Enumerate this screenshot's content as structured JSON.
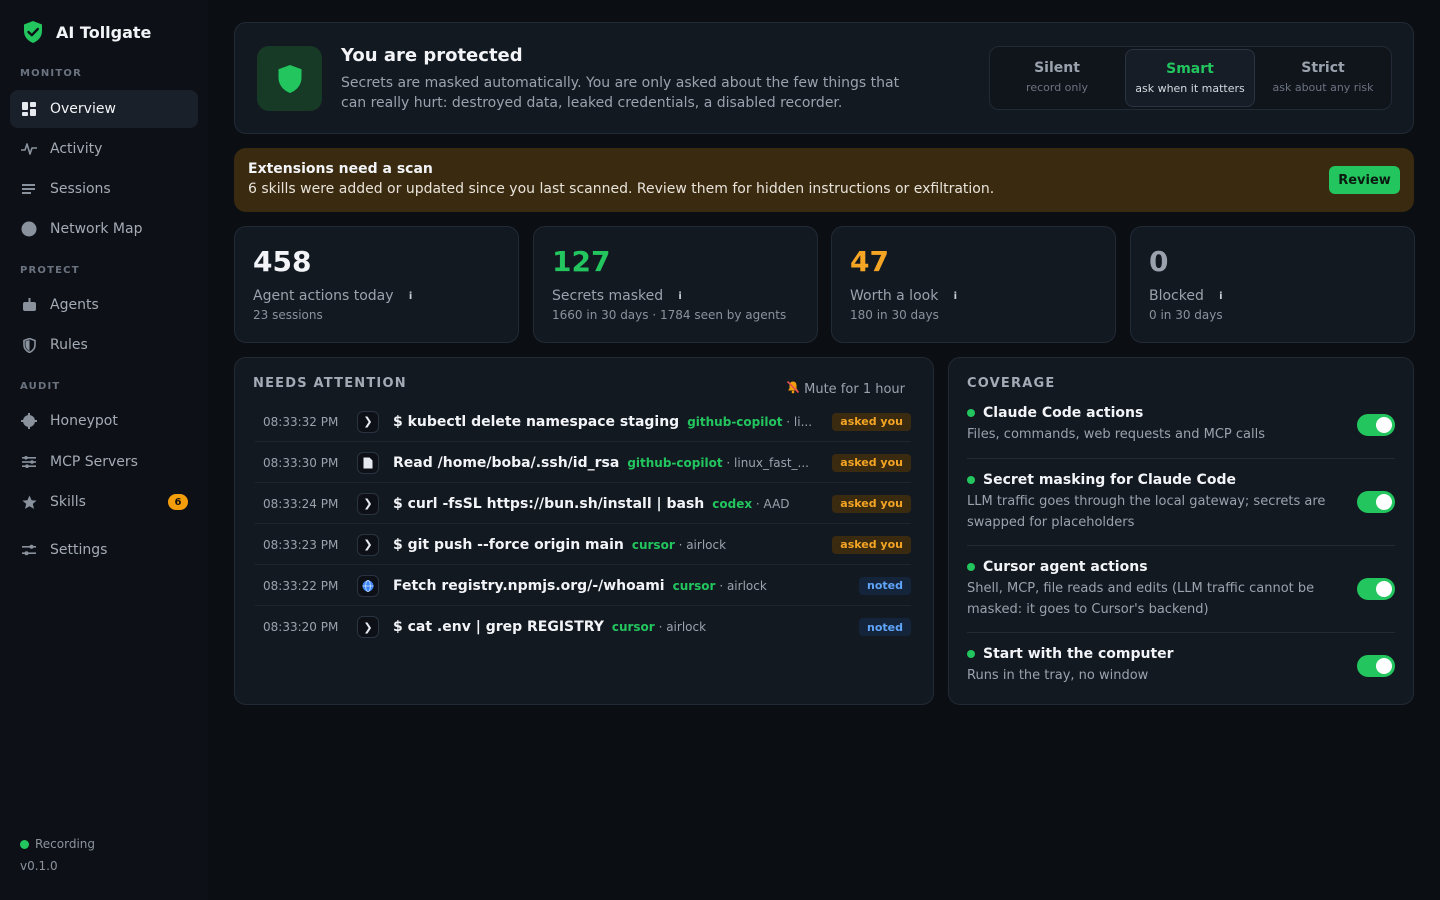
{
  "app": {
    "name": "AI Tollgate",
    "version": "v0.1.0",
    "recording_label": "Recording"
  },
  "sidebar": {
    "sections": {
      "monitor": "MONITOR",
      "protect": "PROTECT",
      "audit": "AUDIT"
    },
    "items": {
      "overview": "Overview",
      "activity": "Activity",
      "sessions": "Sessions",
      "network_map": "Network Map",
      "agents": "Agents",
      "rules": "Rules",
      "honeypot": "Honeypot",
      "mcp_servers": "MCP Servers",
      "skills": "Skills",
      "skills_badge": "6",
      "settings": "Settings"
    }
  },
  "hero": {
    "title": "You are protected",
    "description": "Secrets are masked automatically. You are only asked about the few things that can really hurt: destroyed data, leaked credentials, a disabled recorder.",
    "modes": [
      {
        "name": "Silent",
        "sub": "record only"
      },
      {
        "name": "Smart",
        "sub": "ask when it matters"
      },
      {
        "name": "Strict",
        "sub": "ask about any risk"
      }
    ],
    "selected_mode": "Smart"
  },
  "banner": {
    "title": "Extensions need a scan",
    "text": "6 skills were added or updated since you last scanned. Review them for hidden instructions or exfiltration.",
    "button": "Review"
  },
  "stats": [
    {
      "value": "458",
      "label": "Agent actions today",
      "sub": "23 sessions",
      "color": "#f2f4f7"
    },
    {
      "value": "127",
      "label": "Secrets masked",
      "sub": "1660 in 30 days · 1784 seen by agents",
      "color": "#22c55e"
    },
    {
      "value": "47",
      "label": "Worth a look",
      "sub": "180 in 30 days",
      "color": "#f5a524"
    },
    {
      "value": "0",
      "label": "Blocked",
      "sub": "0 in 30 days",
      "color": "#9aa2ad"
    }
  ],
  "attention": {
    "title": "NEEDS ATTENTION",
    "mute": "Mute for 1 hour",
    "rows": [
      {
        "time": "08:33:32 PM",
        "icon": "terminal-icon",
        "cmd": "$ kubectl delete namespace staging",
        "agent": "github-copilot",
        "context": "· li...",
        "status": "asked you"
      },
      {
        "time": "08:33:30 PM",
        "icon": "file-icon",
        "cmd": "Read /home/boba/.ssh/id_rsa",
        "agent": "github-copilot",
        "context": "· linux_fast_...",
        "status": "asked you"
      },
      {
        "time": "08:33:24 PM",
        "icon": "terminal-icon",
        "cmd": "$ curl -fsSL https://bun.sh/install | bash",
        "agent": "codex",
        "context": "· AAD",
        "status": "asked you"
      },
      {
        "time": "08:33:23 PM",
        "icon": "terminal-icon",
        "cmd": "$ git push --force origin main",
        "agent": "cursor",
        "context": "· airlock",
        "status": "asked you"
      },
      {
        "time": "08:33:22 PM",
        "icon": "globe-icon",
        "cmd": "Fetch registry.npmjs.org/-/whoami",
        "agent": "cursor",
        "context": "· airlock",
        "status": "noted"
      },
      {
        "time": "08:33:20 PM",
        "icon": "terminal-icon",
        "cmd": "$ cat .env | grep REGISTRY",
        "agent": "cursor",
        "context": "· airlock",
        "status": "noted"
      }
    ]
  },
  "coverage": {
    "title": "COVERAGE",
    "items": [
      {
        "title": "Claude Code actions",
        "desc": "Files, commands, web requests and MCP calls",
        "enabled": true
      },
      {
        "title": "Secret masking for Claude Code",
        "desc": "LLM traffic goes through the local gateway; secrets are swapped for placeholders",
        "enabled": true
      },
      {
        "title": "Cursor agent actions",
        "desc": "Shell, MCP, file reads and edits (LLM traffic cannot be masked: it goes to Cursor's backend)",
        "enabled": true
      },
      {
        "title": "Start with the computer",
        "desc": "Runs in the tray, no window",
        "enabled": true
      }
    ]
  },
  "colors": {
    "accent": "#22c55e",
    "warning": "#f5a524",
    "info": "#60a5fa",
    "background": "#0b0e13"
  }
}
